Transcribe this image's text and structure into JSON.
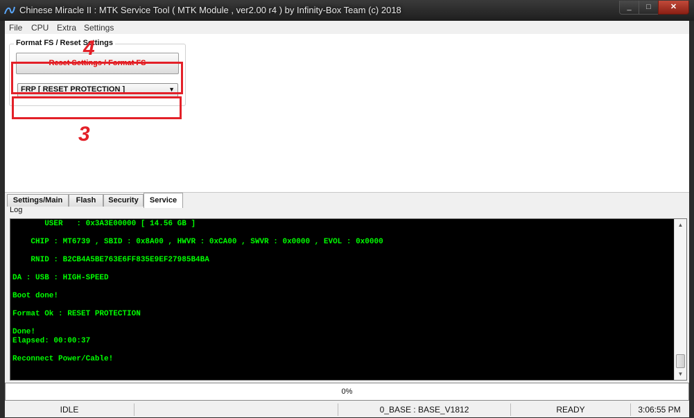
{
  "window": {
    "title": "Chinese Miracle II : MTK Service Tool ( MTK Module , ver2.00 r4  ) by Infinity-Box Team (c) 2018",
    "minimize_glyph": "_",
    "maximize_glyph": "□",
    "close_glyph": "✕"
  },
  "menu": [
    "File",
    "CPU",
    "Extra",
    "Settings"
  ],
  "format_group": {
    "title": "Format FS / Reset Settings",
    "reset_button_label": "Reset Settings / Format FS",
    "mode_selected": "FRP [ RESET PROTECTION ]"
  },
  "annotations": {
    "step_reset_button": "4",
    "step_mode_select": "3",
    "color": "#e32028"
  },
  "tabs": [
    "Settings/Main",
    "Flash",
    "Security",
    "Service"
  ],
  "active_tab": "Service",
  "log": {
    "label": "Log",
    "lines": [
      "       USER   : 0x3A3E00000 [ 14.56 GB ]",
      "",
      "    CHIP : MT6739 , SBID : 0x8A00 , HWVR : 0xCA00 , SWVR : 0x0000 , EVOL : 0x0000",
      "",
      "    RNID : B2CB4A5BE763E6FF835E9EF27985B4BA",
      "",
      "DA : USB : HIGH-SPEED",
      "",
      "Boot done!",
      "",
      "Format Ok : RESET PROTECTION",
      "",
      "Done!",
      "Elapsed: 00:00:37",
      "",
      "Reconnect Power/Cable!"
    ],
    "text_color": "#00ff00"
  },
  "progress": {
    "percent": 0,
    "label": "0%"
  },
  "status": {
    "state": "IDLE",
    "field2": "",
    "base": "0_BASE : BASE_V1812",
    "ready": "READY",
    "time": "3:06:55 PM"
  }
}
